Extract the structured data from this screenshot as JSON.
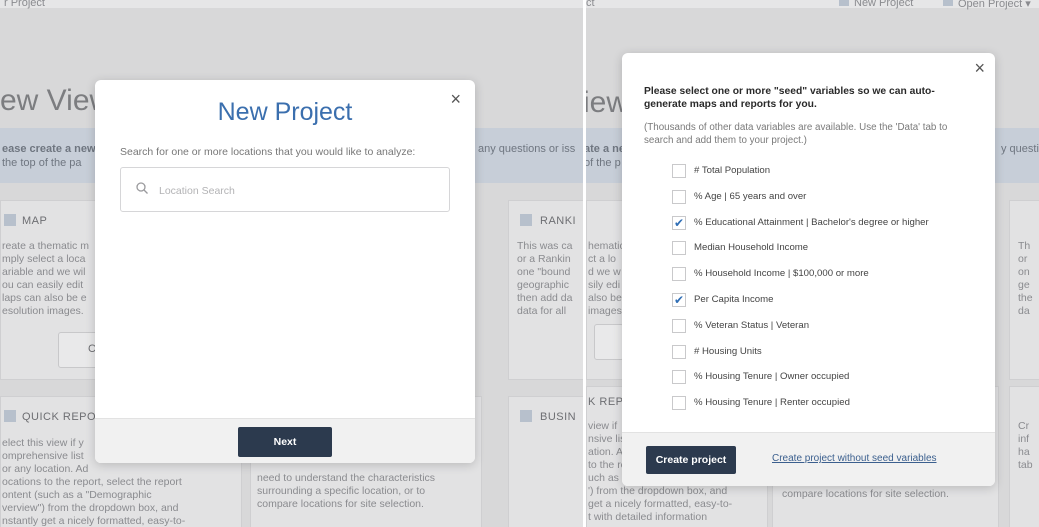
{
  "left": {
    "background": {
      "top_text": "r Project",
      "title": "ew View",
      "band_line1": "ease create a new",
      "band_line2": "the top of the pa",
      "band_right": "any questions or iss",
      "cards": [
        {
          "title": "MAP",
          "body": [
            "reate a thematic m",
            "mply select a loca",
            "ariable and we wil",
            "ou can easily edit",
            "laps can also be e",
            "esolution images."
          ]
        },
        {
          "title": "RANKI",
          "body": [
            "This was ca",
            "or a Rankin",
            "one \"bound",
            "geographic",
            "then add da",
            "data for all"
          ]
        },
        {
          "title": "QUICK REPOR",
          "body": [
            "elect this view if y",
            "omprehensive list",
            "or any location. Ad",
            "ocations to the report, select the report",
            "ontent (such as a \"Demographic",
            "verview\") from the dropdown box, and",
            "nstantly get a nicely formatted, easy-to-"
          ]
        },
        {
          "title": "BUSIN",
          "body": [
            "need to understand the characteristics",
            "surrounding a specific location, or to",
            "compare locations for site selection."
          ]
        }
      ],
      "card_btn_letter": "C"
    },
    "modal": {
      "title": "New Project",
      "prompt": "Search for one or more locations that you would like to analyze:",
      "search": {
        "placeholder": "Location Search",
        "value": ""
      },
      "next_label": "Next",
      "close_glyph": "×"
    }
  },
  "right": {
    "background": {
      "top_left": "ct",
      "new_project": "New Project",
      "open_project": "Open Project ▾",
      "title": "iew",
      "band_line1": "ate a ne",
      "band_line2": "of the p",
      "band_right": "y questio",
      "card_snips_left": [
        "hematic",
        "ct a lo",
        "d we w",
        "sily edi",
        "also be",
        "images"
      ],
      "card_snips_right": [
        "Th",
        "or",
        "on",
        "ge",
        "the",
        "da"
      ],
      "report_title": "K REPO",
      "report_body": [
        "view if",
        "nsive lis",
        "ation. A",
        "to the re",
        "uch as a",
        "') from the dropdown box, and",
        "get a nicely formatted, easy-to-",
        "t with detailed information"
      ],
      "bottom_right_text": "compare locations for site selection.",
      "cr_snips": [
        "Cr",
        "inf",
        "ha",
        "tab"
      ]
    },
    "modal": {
      "heading": "Please select one or more \"seed\" variables so we can auto-generate maps and reports for you.",
      "note": "(Thousands of other data variables are available. Use the 'Data' tab to search and add them to your project.)",
      "close_glyph": "×",
      "variables": [
        {
          "label": "# Total Population",
          "checked": false
        },
        {
          "label": "% Age | 65 years and over",
          "checked": false
        },
        {
          "label": "% Educational Attainment | Bachelor's degree or higher",
          "checked": true
        },
        {
          "label": "Median Household Income",
          "checked": false
        },
        {
          "label": "% Household Income | $100,000 or more",
          "checked": false
        },
        {
          "label": "Per Capita Income",
          "checked": true
        },
        {
          "label": "% Veteran Status | Veteran",
          "checked": false
        },
        {
          "label": "# Housing Units",
          "checked": false
        },
        {
          "label": "% Housing Tenure | Owner occupied",
          "checked": false
        },
        {
          "label": "% Housing Tenure | Renter occupied",
          "checked": false
        }
      ],
      "create_label": "Create project",
      "create_without_label": "Create project without seed variables"
    }
  },
  "colors": {
    "accent": "#3b6fae",
    "button_dark": "#2c3a4e",
    "check": "#2f6eb5",
    "link": "#3b5f8e"
  }
}
